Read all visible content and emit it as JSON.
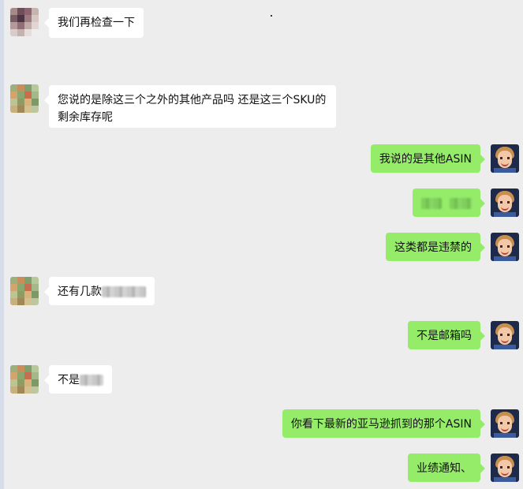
{
  "messages": [
    {
      "side": "in",
      "text": "我们再检查一下",
      "avatar": "contact-avatar-1"
    },
    {
      "side": "in",
      "text": "您说的是除这三个之外的其他产品吗 还是这三个SKU的剩余库存呢",
      "avatar": "contact-avatar-2"
    },
    {
      "side": "out",
      "text": "我说的是其他ASIN",
      "avatar": "self-avatar"
    },
    {
      "side": "out",
      "text": "",
      "avatar": "self-avatar"
    },
    {
      "side": "out",
      "text": "这类都是违禁的",
      "avatar": "self-avatar"
    },
    {
      "side": "in",
      "text": "还有几款",
      "avatar": "contact-avatar-2"
    },
    {
      "side": "out",
      "text": "不是邮箱吗",
      "avatar": "self-avatar"
    },
    {
      "side": "in",
      "text": "不是",
      "avatar": "contact-avatar-2"
    },
    {
      "side": "out",
      "text": "你看下最新的亚马逊抓到的那个ASIN",
      "avatar": "self-avatar"
    },
    {
      "side": "out",
      "text": "业绩通知、",
      "avatar": "self-avatar"
    }
  ],
  "colors": {
    "background": "#ededed",
    "incoming_bubble": "#ffffff",
    "outgoing_bubble": "#95ec69"
  }
}
